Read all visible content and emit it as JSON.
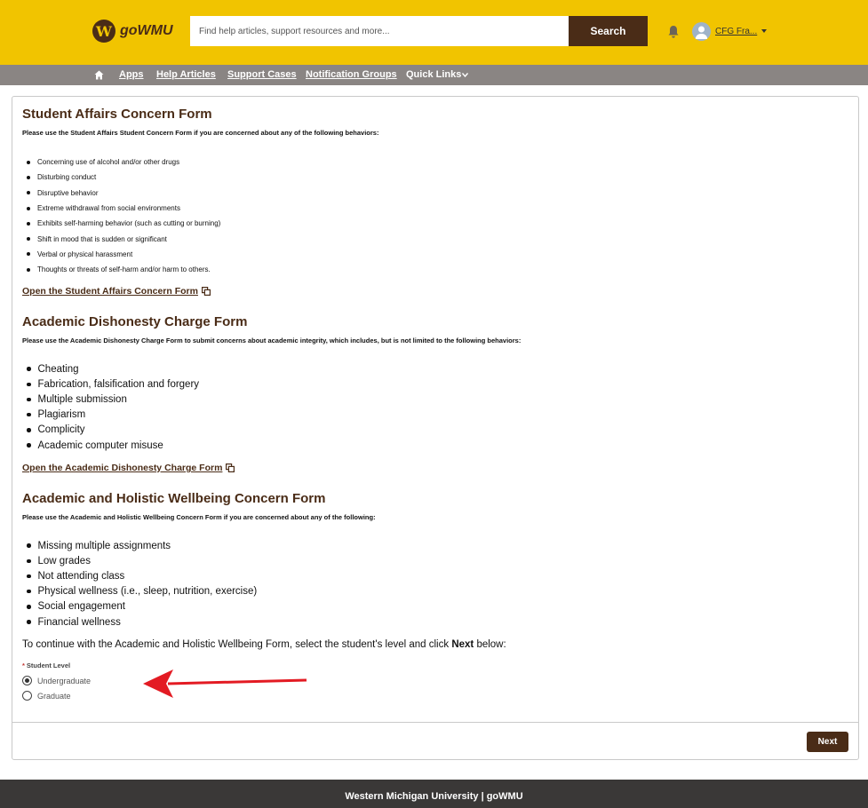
{
  "header": {
    "logo_letter": "W",
    "logo_text": "goWMU",
    "search_placeholder": "Find help articles, support resources and more...",
    "search_button": "Search",
    "user_name": "CFG Fra...",
    "brand_color": "#f1c400",
    "accent_color": "#4a2c17"
  },
  "nav": {
    "home_icon": "home-icon",
    "items": [
      {
        "label": "Apps"
      },
      {
        "label": "Help Articles"
      },
      {
        "label": "Support Cases"
      },
      {
        "label": "Notification Groups"
      },
      {
        "label": "Quick Links"
      }
    ]
  },
  "sections": [
    {
      "title": "Student Affairs Concern Form",
      "intro": "Please use the Student Affairs Student Concern Form if you are concerned about any of the following behaviors:",
      "items": [
        "Concerning use of alcohol and/or other drugs",
        "Disturbing conduct",
        "Disruptive behavior",
        "Extreme withdrawal from social environments",
        "Exhibits self-harming behavior (such as cutting or burning)",
        "Shift in mood that is sudden or significant",
        "Verbal or physical harassment",
        "Thoughts or threats of self-harm and/or harm to others."
      ],
      "link": "Open the Student Affairs Concern Form"
    },
    {
      "title": "Academic Dishonesty Charge Form",
      "intro": "Please use the Academic Dishonesty Charge Form to submit concerns about academic integrity, which includes, but is not limited to the following behaviors:",
      "items": [
        "Cheating",
        "Fabrication, falsification and forgery",
        "Multiple submission",
        "Plagiarism",
        "Complicity",
        "Academic computer misuse"
      ],
      "link": "Open the Academic Dishonesty Charge Form"
    },
    {
      "title": "Academic and Holistic Wellbeing Concern Form",
      "intro": "Please use the Academic and Holistic Wellbeing Concern Form if you are concerned about any of the following:",
      "items": [
        "Missing multiple assignments",
        "Low grades",
        "Not attending class",
        "Physical wellness (i.e., sleep, nutrition, exercise)",
        "Social engagement",
        "Financial wellness"
      ]
    }
  ],
  "continue": {
    "text": "To continue with the Academic and Holistic Wellbeing Form, select the student's level and click ",
    "emphasis": "Next",
    "suffix": " below:"
  },
  "student_level": {
    "required_mark": "*",
    "label": "Student Level",
    "options": [
      {
        "label": "Undergraduate",
        "selected": true
      },
      {
        "label": "Graduate",
        "selected": false
      }
    ]
  },
  "next_button": "Next",
  "footer": "Western Michigan University | goWMU",
  "annotation_arrow_color": "#e31b23"
}
